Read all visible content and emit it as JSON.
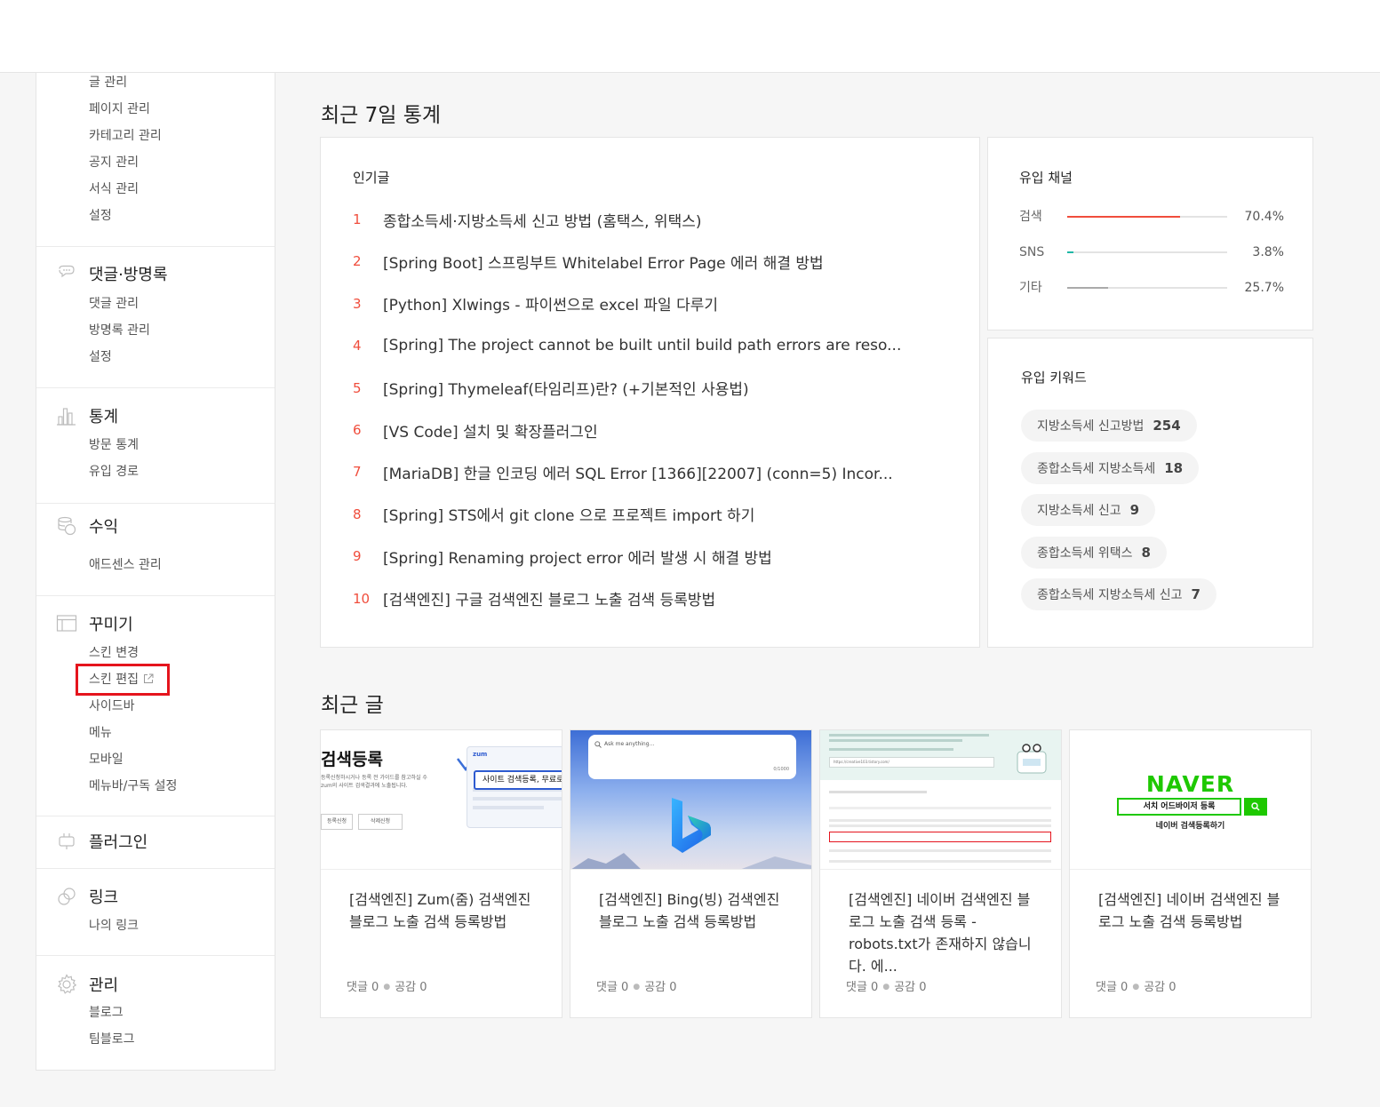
{
  "sidebar": {
    "post_items": [
      "글 관리",
      "페이지 관리",
      "카테고리 관리",
      "공지 관리",
      "서식 관리",
      "설정"
    ],
    "comments": {
      "title": "댓글·방명록",
      "icon": "speech-bubble-icon",
      "items": [
        "댓글 관리",
        "방명록 관리",
        "설정"
      ]
    },
    "stats": {
      "title": "통계",
      "icon": "bar-chart-icon",
      "items": [
        "방문 통계",
        "유입 경로"
      ]
    },
    "revenue": {
      "title": "수익",
      "icon": "coins-icon",
      "items": [
        "애드센스 관리"
      ]
    },
    "decorate": {
      "title": "꾸미기",
      "icon": "layout-icon",
      "items": [
        "스킨 변경",
        "스킨 편집",
        "사이드바",
        "메뉴",
        "모바일",
        "메뉴바/구독 설정"
      ],
      "highlighted_item": "스킨 편집"
    },
    "plugin": {
      "title": "플러그인",
      "icon": "plug-icon"
    },
    "link": {
      "title": "링크",
      "icon": "link-icon",
      "items": [
        "나의 링크"
      ]
    },
    "manage": {
      "title": "관리",
      "icon": "gear-icon",
      "items": [
        "블로그",
        "팀블로그"
      ]
    }
  },
  "stats_section": {
    "title": "최근 7일 통계",
    "popular": {
      "label": "인기글",
      "accent_color": "#f04d3c",
      "items": [
        {
          "rank": "1",
          "title": "종합소득세·지방소득세 신고 방법 (홈택스, 위택스)"
        },
        {
          "rank": "2",
          "title": "[Spring Boot] 스프링부트 Whitelabel Error Page 에러 해결 방법"
        },
        {
          "rank": "3",
          "title": "[Python] Xlwings - 파이썬으로 excel 파일 다루기"
        },
        {
          "rank": "4",
          "title": "[Spring] The project cannot be built until build path errors are reso..."
        },
        {
          "rank": "5",
          "title": "[Spring] Thymeleaf(타임리프)란? (+기본적인 사용법)"
        },
        {
          "rank": "6",
          "title": "[VS Code] 설치 및 확장플러그인"
        },
        {
          "rank": "7",
          "title": "[MariaDB] 한글 인코딩 에러 SQL Error [1366][22007] (conn=5) Incor..."
        },
        {
          "rank": "8",
          "title": "[Spring] STS에서 git clone 으로 프로젝트 import 하기"
        },
        {
          "rank": "9",
          "title": "[Spring] Renaming project error 에러 발생 시 해결 방법"
        },
        {
          "rank": "10",
          "title": "[검색엔진] 구글 검색엔진 블로그 노출 검색 등록방법"
        }
      ]
    },
    "channels": {
      "label": "유입 채널",
      "items": [
        {
          "name": "검색",
          "percent": "70.4%",
          "fraction": 0.704,
          "color": "#f04d3c"
        },
        {
          "name": "SNS",
          "percent": "3.8%",
          "fraction": 0.038,
          "color": "#1fb7a6"
        },
        {
          "name": "기타",
          "percent": "25.7%",
          "fraction": 0.257,
          "color": "#aaaaaa"
        }
      ]
    },
    "keywords": {
      "label": "유입 키워드",
      "items": [
        {
          "text": "지방소득세 신고방법",
          "count": "254"
        },
        {
          "text": "종합소득세 지방소득세",
          "count": "18"
        },
        {
          "text": "지방소득세 신고",
          "count": "9"
        },
        {
          "text": "종합소득세 위택스",
          "count": "8"
        },
        {
          "text": "종합소득세 지방소득세 신고",
          "count": "7"
        }
      ]
    }
  },
  "recent_section": {
    "title": "최근 글",
    "posts": [
      {
        "title": "[검색엔진] Zum(줌) 검색엔진 블로그 노출 검색 등록방법",
        "comments": "댓글 0",
        "likes": "공감 0",
        "thumb": {
          "heading": "검색등록",
          "line1": "등록신청하시거나 등록 전 가이드를 참고하실 수",
          "line2": "zum의 사이트 검색결과에 노출됩니다.",
          "btn1": "등록신청",
          "btn2": "삭제신청",
          "banner": "사이트 검색등록, 무료로",
          "logo": "zum"
        }
      },
      {
        "title": "[검색엔진] Bing(빙) 검색엔진 블로그 노출 검색 등록방법",
        "comments": "댓글 0",
        "likes": "공감 0",
        "thumb": {
          "placeholder": "Ask me anything...",
          "counter": "0/1000"
        }
      },
      {
        "title": "[검색엔진] 네이버 검색엔진 블로그 노출 검색 등록 - robots.txt가 존재하지 않습니다. 에...",
        "comments": "댓글 0",
        "likes": "공감 0",
        "thumb": {
          "url": "https://creative103.tistory.com/"
        }
      },
      {
        "title": "[검색엔진] 네이버 검색엔진 블로그 노출 검색 등록방법",
        "comments": "댓글 0",
        "likes": "공감 0",
        "thumb": {
          "logo": "NAVER",
          "search_box": "서치 어드바이저 등록",
          "caption": "네이버 검색등록하기"
        }
      }
    ]
  }
}
